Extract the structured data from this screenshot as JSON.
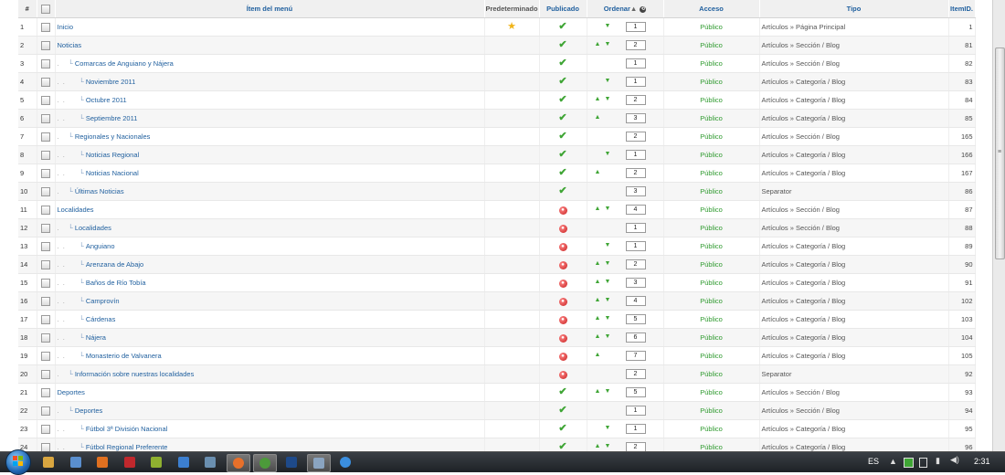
{
  "headers": {
    "num": "#",
    "item": "Ítem del menú",
    "default": "Predeterminado",
    "published": "Publicado",
    "order": "Ordenar",
    "access": "Acceso",
    "type": "Tipo",
    "itemid": "ItemID."
  },
  "rows": [
    {
      "n": "1",
      "depth": 0,
      "title": "Inicio",
      "def": true,
      "pub": "check",
      "up": false,
      "down": true,
      "order": "1",
      "access": "Público",
      "type": "Artículos » Página Principal",
      "id": "1"
    },
    {
      "n": "2",
      "depth": 0,
      "title": "Noticias",
      "def": false,
      "pub": "check",
      "up": true,
      "down": true,
      "order": "2",
      "access": "Público",
      "type": "Artículos » Sección / Blog",
      "id": "81"
    },
    {
      "n": "3",
      "depth": 1,
      "title": "Comarcas de Anguiano y Nájera",
      "def": false,
      "pub": "check",
      "up": false,
      "down": false,
      "order": "1",
      "access": "Público",
      "type": "Artículos » Sección / Blog",
      "id": "82"
    },
    {
      "n": "4",
      "depth": 2,
      "title": "Noviembre 2011",
      "def": false,
      "pub": "check",
      "up": false,
      "down": true,
      "order": "1",
      "access": "Público",
      "type": "Artículos » Categoría / Blog",
      "id": "83"
    },
    {
      "n": "5",
      "depth": 2,
      "title": "Octubre 2011",
      "def": false,
      "pub": "check",
      "up": true,
      "down": true,
      "order": "2",
      "access": "Público",
      "type": "Artículos » Categoría / Blog",
      "id": "84"
    },
    {
      "n": "6",
      "depth": 2,
      "title": "Septiembre 2011",
      "def": false,
      "pub": "check",
      "up": true,
      "down": false,
      "order": "3",
      "access": "Público",
      "type": "Artículos » Categoría / Blog",
      "id": "85"
    },
    {
      "n": "7",
      "depth": 1,
      "title": "Regionales y Nacionales",
      "def": false,
      "pub": "check",
      "up": false,
      "down": false,
      "order": "2",
      "access": "Público",
      "type": "Artículos » Sección / Blog",
      "id": "165"
    },
    {
      "n": "8",
      "depth": 2,
      "title": "Noticias Regional",
      "def": false,
      "pub": "check",
      "up": false,
      "down": true,
      "order": "1",
      "access": "Público",
      "type": "Artículos » Categoría / Blog",
      "id": "166"
    },
    {
      "n": "9",
      "depth": 2,
      "title": "Noticias Nacional",
      "def": false,
      "pub": "check",
      "up": true,
      "down": false,
      "order": "2",
      "access": "Público",
      "type": "Artículos » Categoría / Blog",
      "id": "167"
    },
    {
      "n": "10",
      "depth": 1,
      "title": "Últimas Noticias",
      "def": false,
      "pub": "check",
      "up": false,
      "down": false,
      "order": "3",
      "access": "Público",
      "type": "Separator",
      "id": "86"
    },
    {
      "n": "11",
      "depth": 0,
      "title": "Localidades",
      "def": false,
      "pub": "cross",
      "up": true,
      "down": true,
      "order": "4",
      "access": "Público",
      "type": "Artículos » Sección / Blog",
      "id": "87"
    },
    {
      "n": "12",
      "depth": 1,
      "title": "Localidades",
      "def": false,
      "pub": "cross",
      "up": false,
      "down": false,
      "order": "1",
      "access": "Público",
      "type": "Artículos » Sección / Blog",
      "id": "88"
    },
    {
      "n": "13",
      "depth": 2,
      "title": "Anguiano",
      "def": false,
      "pub": "cross",
      "up": false,
      "down": true,
      "order": "1",
      "access": "Público",
      "type": "Artículos » Categoría / Blog",
      "id": "89"
    },
    {
      "n": "14",
      "depth": 2,
      "title": "Arenzana de Abajo",
      "def": false,
      "pub": "cross",
      "up": true,
      "down": true,
      "order": "2",
      "access": "Público",
      "type": "Artículos » Categoría / Blog",
      "id": "90"
    },
    {
      "n": "15",
      "depth": 2,
      "title": "Baños de Río Tobía",
      "def": false,
      "pub": "cross",
      "up": true,
      "down": true,
      "order": "3",
      "access": "Público",
      "type": "Artículos » Categoría / Blog",
      "id": "91"
    },
    {
      "n": "16",
      "depth": 2,
      "title": "Camprovín",
      "def": false,
      "pub": "cross",
      "up": true,
      "down": true,
      "order": "4",
      "access": "Público",
      "type": "Artículos » Categoría / Blog",
      "id": "102"
    },
    {
      "n": "17",
      "depth": 2,
      "title": "Cárdenas",
      "def": false,
      "pub": "cross",
      "up": true,
      "down": true,
      "order": "5",
      "access": "Público",
      "type": "Artículos » Categoría / Blog",
      "id": "103"
    },
    {
      "n": "18",
      "depth": 2,
      "title": "Nájera",
      "def": false,
      "pub": "cross",
      "up": true,
      "down": true,
      "order": "6",
      "access": "Público",
      "type": "Artículos » Categoría / Blog",
      "id": "104"
    },
    {
      "n": "19",
      "depth": 2,
      "title": "Monasterio de Valvanera",
      "def": false,
      "pub": "cross",
      "up": true,
      "down": false,
      "order": "7",
      "access": "Público",
      "type": "Artículos » Categoría / Blog",
      "id": "105"
    },
    {
      "n": "20",
      "depth": 1,
      "title": "Información sobre nuestras localidades",
      "def": false,
      "pub": "cross",
      "up": false,
      "down": false,
      "order": "2",
      "access": "Público",
      "type": "Separator",
      "id": "92"
    },
    {
      "n": "21",
      "depth": 0,
      "title": "Deportes",
      "def": false,
      "pub": "check",
      "up": true,
      "down": true,
      "order": "5",
      "access": "Público",
      "type": "Artículos » Sección / Blog",
      "id": "93"
    },
    {
      "n": "22",
      "depth": 1,
      "title": "Deportes",
      "def": false,
      "pub": "check",
      "up": false,
      "down": false,
      "order": "1",
      "access": "Público",
      "type": "Artículos » Sección / Blog",
      "id": "94"
    },
    {
      "n": "23",
      "depth": 2,
      "title": "Fútbol 3ª División Nacional",
      "def": false,
      "pub": "check",
      "up": false,
      "down": true,
      "order": "1",
      "access": "Público",
      "type": "Artículos » Categoría / Blog",
      "id": "95"
    },
    {
      "n": "24",
      "depth": 2,
      "title": "Fútbol Regional Preferente",
      "def": false,
      "pub": "check",
      "up": true,
      "down": true,
      "order": "2",
      "access": "Público",
      "type": "Artículos » Categoría / Blog",
      "id": "96"
    }
  ],
  "taskbar": {
    "language": "ES",
    "clock": "2:31",
    "apps": [
      "explorer-icon",
      "media-player-icon",
      "app-orange-icon",
      "app-red-icon",
      "app-green-icon",
      "app-blue-icon",
      "app-phone-icon",
      "firefox-icon",
      "chrome-icon",
      "photoshop-icon",
      "app-window-icon",
      "internet-explorer-icon"
    ],
    "colors": [
      "#d9a640",
      "#5a8fcf",
      "#e07020",
      "#c0282d",
      "#8fb030",
      "#3c7fd0",
      "#6a8fb0",
      "#e8702a",
      "#4c9a3a",
      "#1e4a8a",
      "#8aa4c0",
      "#3b8fe0"
    ]
  }
}
